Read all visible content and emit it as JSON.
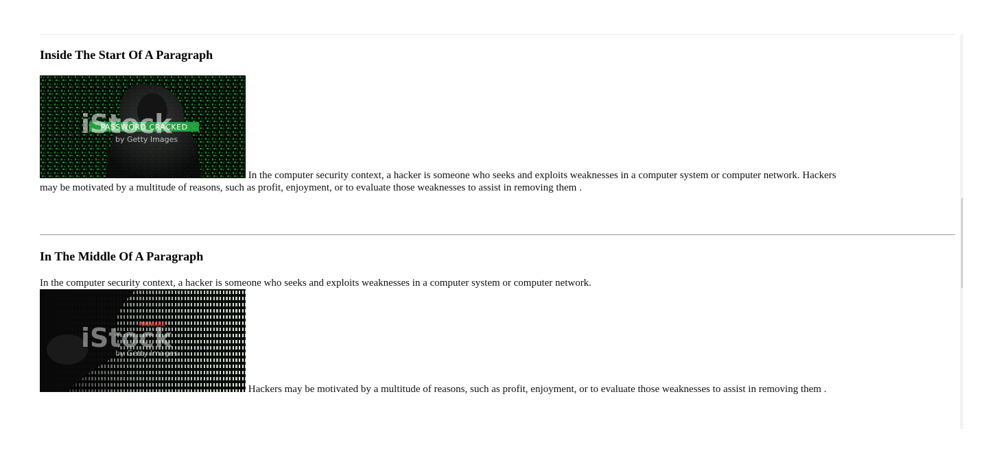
{
  "sections": [
    {
      "heading": "Inside The Start Of A Paragraph",
      "image": {
        "watermark": "iStock",
        "byline": "by Getty Images",
        "overlay_label": "PASSWORD CRACKED",
        "icon": "hacker-password-image"
      },
      "text_after_image": "In the computer security context, a hacker is someone who seeks and exploits weaknesses in a computer system or computer network. Hackers may be motivated by a multitude of reasons, such as profit, enjoyment, or to evaluate those weaknesses to assist in removing them ."
    },
    {
      "heading": "In The Middle Of A Paragraph",
      "text_before_image": "In the computer security context, a hacker is someone who seeks and exploits weaknesses in a computer system or computer network.",
      "image": {
        "watermark": "iStock",
        "byline": "by Getty Images",
        "overlay_label": "MALWARE",
        "icon": "hacker-malware-image"
      },
      "text_after_image": "Hackers may be motivated by a multitude of reasons, such as profit, enjoyment, or to evaluate those weaknesses to assist in removing them ."
    }
  ],
  "colors": {
    "matrix_green": "#1fae3a",
    "binary_white": "#e8f4ea",
    "malware_red": "#e63a2e",
    "divider": "#9a9a9a"
  }
}
